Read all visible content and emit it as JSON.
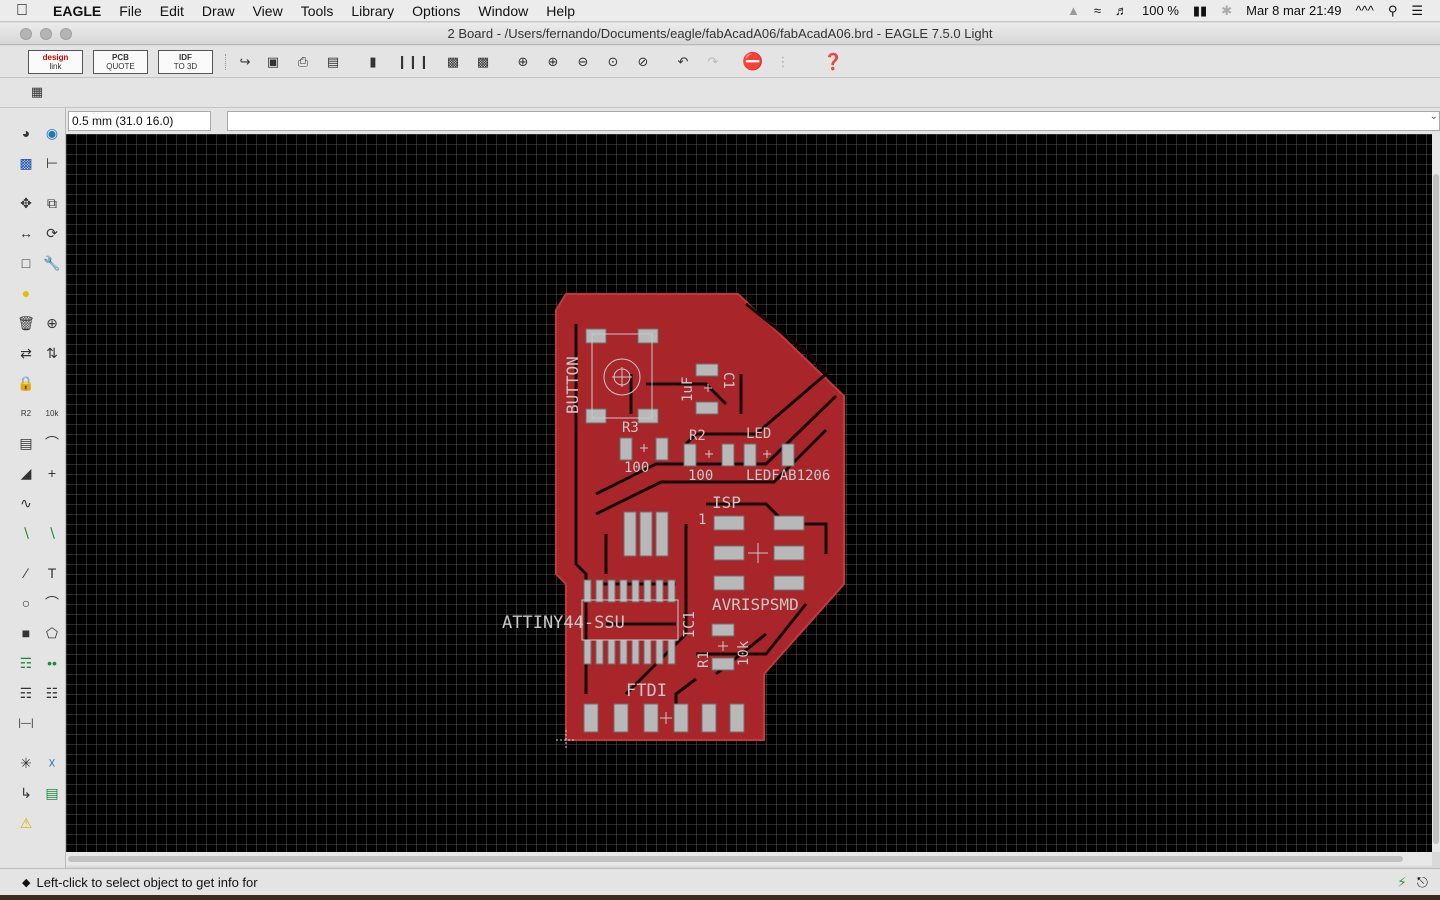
{
  "menubar": {
    "apple": "",
    "items": [
      "EAGLE",
      "File",
      "Edit",
      "Draw",
      "View",
      "Tools",
      "Library",
      "Options",
      "Window",
      "Help"
    ],
    "battery": "100 %",
    "clock": "Mar 8 mar  21:49"
  },
  "window": {
    "title": "2 Board - /Users/fernando/Documents/eagle/fabAcadA06/fabAcadA06.brd - EAGLE 7.5.0 Light"
  },
  "toolbar": {
    "design_link": {
      "line1": "design",
      "line2": "link"
    },
    "pcb_quote": {
      "line1": "PCB",
      "line2": "QUOTE"
    },
    "idf": {
      "line1": "IDF",
      "line2": "TO 3D"
    }
  },
  "command": {
    "coordinates": "0.5 mm (31.0 16.0)",
    "input_value": ""
  },
  "board": {
    "labels": {
      "button": "BUTTON",
      "r3": "R3",
      "r3_value": "100",
      "c1": "C1",
      "c1_value": "1uF",
      "r2": "R2",
      "r2_value": "100",
      "led": "LED",
      "led_value": "LEDFAB1206",
      "isp": "ISP",
      "isp_pin1": "1",
      "isp_value": "AVRISPSMD",
      "ic1": "IC1",
      "ic1_value": "ATTINY44-SSU",
      "r1": "R1",
      "r1_value": "10k",
      "ftdi": "FTDI"
    },
    "colors": {
      "copper": "#a8262a",
      "copper_edge": "#c03a3c",
      "pad": "#b8b8b8",
      "silk": "#c8c8c8"
    }
  },
  "status": {
    "message": "Left-click to select object to get info for"
  }
}
